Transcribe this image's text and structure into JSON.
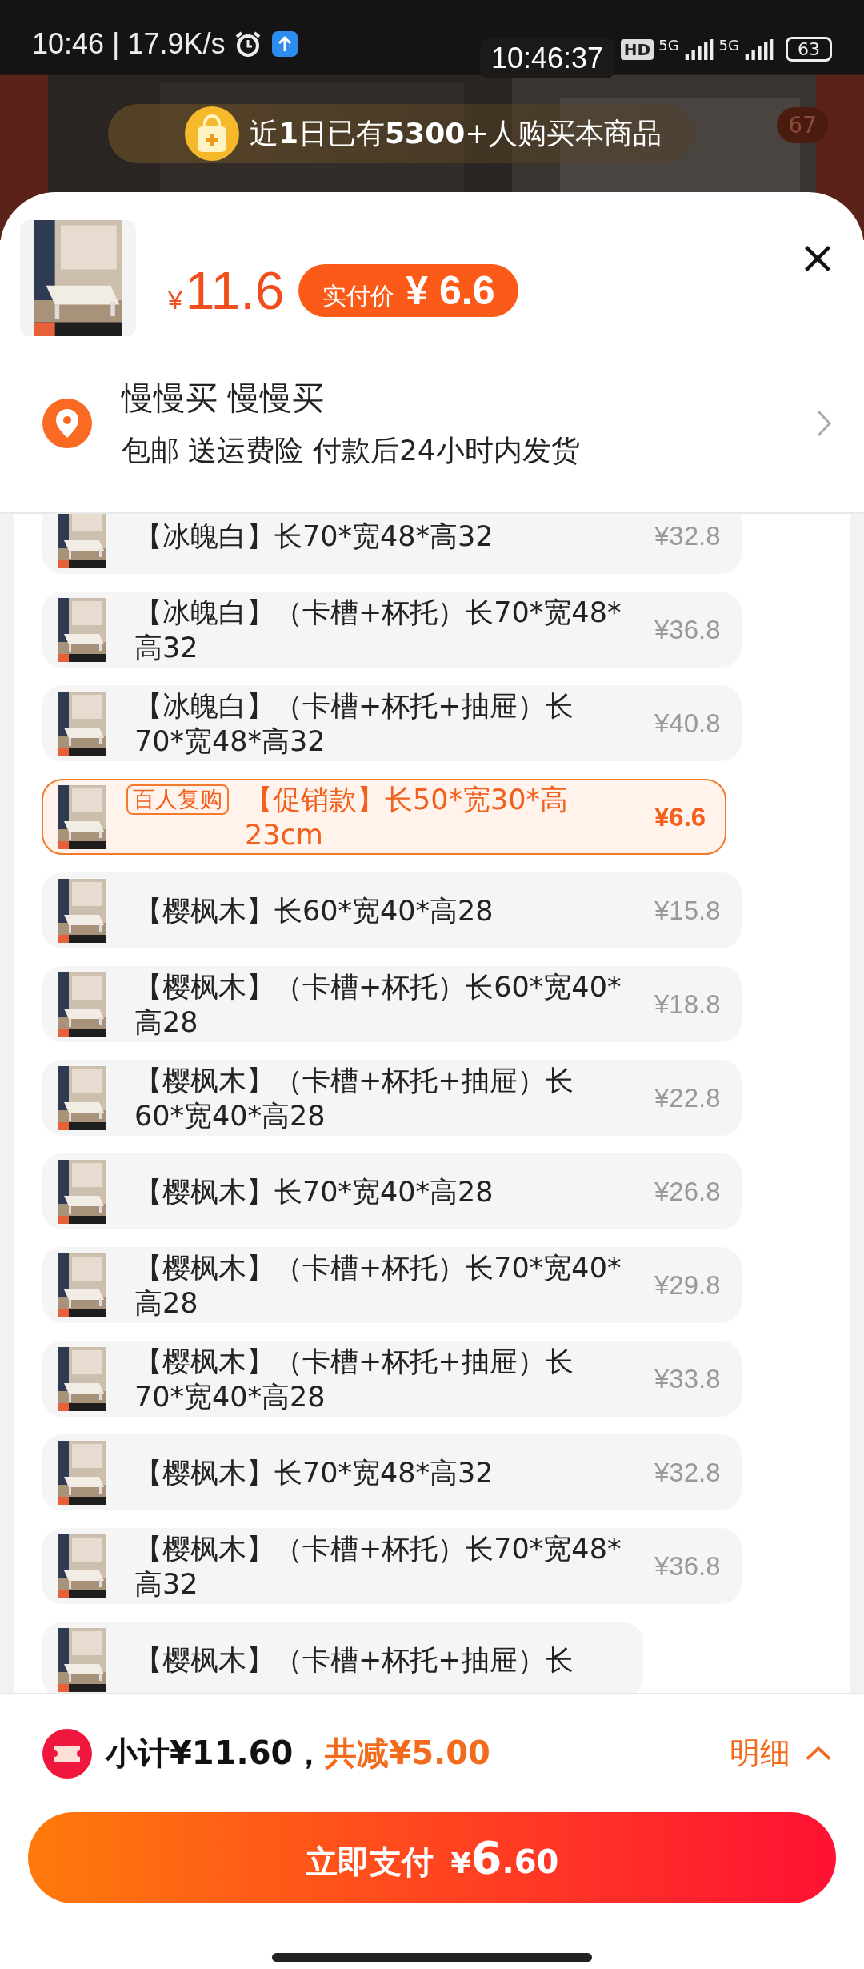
{
  "status_bar": {
    "time": "10:46",
    "speed": "| 17.9K/s",
    "clock": "10:46:37",
    "hd": "HD",
    "networks": [
      "5G",
      "5G"
    ],
    "battery": "63"
  },
  "banner": {
    "text": "近**1**日已有**5300**+人购买本商品",
    "badge": "67"
  },
  "product": {
    "currency": "¥",
    "price": "11.6",
    "badge_label": "实付价",
    "badge_price": "¥ 6.6"
  },
  "address": {
    "name": "慢慢买 慢慢买",
    "detail": "包邮 送运费险 付款后24小时内发货"
  },
  "variants": [
    {
      "name": "【冰魄白】长70*宽48*高32",
      "price": "¥32.8",
      "selected": false
    },
    {
      "name": "【冰魄白】（卡槽+杯托）长70*宽48*高32",
      "price": "¥36.8",
      "selected": false
    },
    {
      "name": "【冰魄白】（卡槽+杯托+抽屉）长70*宽48*高32",
      "price": "¥40.8",
      "selected": false
    },
    {
      "name": "【促销款】长50*宽30*高23cm",
      "price": "¥6.6",
      "selected": true,
      "tag": "百人复购"
    },
    {
      "name": "【樱枫木】长60*宽40*高28",
      "price": "¥15.8",
      "selected": false
    },
    {
      "name": "【樱枫木】（卡槽+杯托）长60*宽40*高28",
      "price": "¥18.8",
      "selected": false
    },
    {
      "name": "【樱枫木】（卡槽+杯托+抽屉）长60*宽40*高28",
      "price": "¥22.8",
      "selected": false
    },
    {
      "name": "【樱枫木】长70*宽40*高28",
      "price": "¥26.8",
      "selected": false
    },
    {
      "name": "【樱枫木】（卡槽+杯托）长70*宽40*高28",
      "price": "¥29.8",
      "selected": false
    },
    {
      "name": "【樱枫木】（卡槽+杯托+抽屉）长70*宽40*高28",
      "price": "¥33.8",
      "selected": false
    },
    {
      "name": "【樱枫木】长70*宽48*高32",
      "price": "¥32.8",
      "selected": false
    },
    {
      "name": "【樱枫木】（卡槽+杯托）长70*宽48*高32",
      "price": "¥36.8",
      "selected": false
    },
    {
      "name": "【樱枫木】（卡槽+杯托+抽屉）长",
      "selected": false
    }
  ],
  "summary": {
    "subtotal": "小计¥11.60，",
    "discount": "共减¥5.00",
    "details": "明细"
  },
  "pay_button": {
    "label": "立即支付",
    "currency": "¥",
    "integer": "6",
    "decimal": ".60"
  }
}
